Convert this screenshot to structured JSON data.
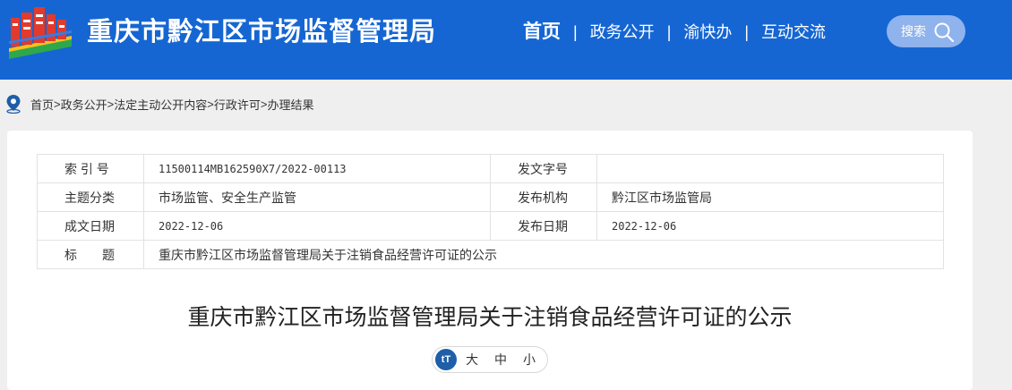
{
  "header": {
    "site_title": "重庆市黔江区市场监督管理局",
    "nav": [
      {
        "label": "首页",
        "active": true
      },
      {
        "label": "政务公开",
        "active": false
      },
      {
        "label": "渝快办",
        "active": false
      },
      {
        "label": "互动交流",
        "active": false
      }
    ],
    "nav_separator": "|",
    "search_label": "搜索",
    "logo_icon": "city-building-logo-icon",
    "search_icon": "magnifier-icon"
  },
  "breadcrumb": {
    "icon": "location-pin-icon",
    "items": [
      "首页",
      "政务公开",
      "法定主动公开内容",
      "行政许可",
      "办理结果"
    ],
    "separator": ">"
  },
  "meta": {
    "index_label": "索 引 号",
    "index_value": "11500114MB162590X7/2022-00113",
    "doc_no_label": "发文字号",
    "doc_no_value": "",
    "category_label": "主题分类",
    "category_value": "市场监管、安全生产监管",
    "issuer_label": "发布机构",
    "issuer_value": "黔江区市场监管局",
    "created_label": "成文日期",
    "created_value": "2022-12-06",
    "published_label": "发布日期",
    "published_value": "2022-12-06",
    "title_label": "标　　题",
    "title_value": "重庆市黔江区市场监督管理局关于注销食品经营许可证的公示"
  },
  "document": {
    "title": "重庆市黔江区市场监督管理局关于注销食品经营许可证的公示"
  },
  "font_size": {
    "icon_text": "tT",
    "options": [
      "大",
      "中",
      "小"
    ]
  },
  "colors": {
    "header_bg": "#1566d3",
    "search_bg": "#8fb3ec",
    "page_bg": "#efefef",
    "font_icon_bg": "#1f5ea8"
  }
}
